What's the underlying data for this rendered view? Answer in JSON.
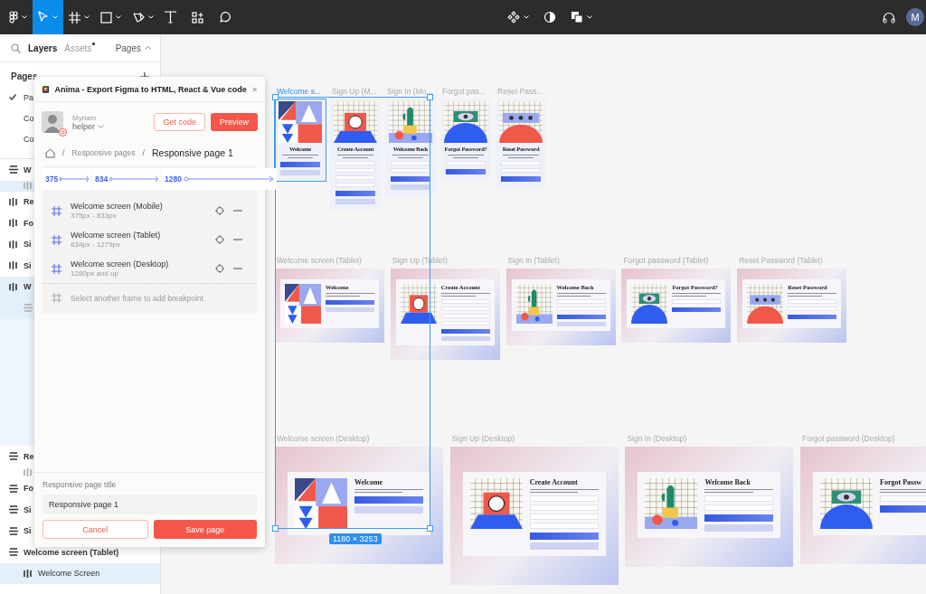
{
  "toolbar": {
    "tools": [
      {
        "kind": "menu",
        "selected": false
      },
      {
        "kind": "move",
        "selected": true
      },
      {
        "kind": "frame",
        "selected": false
      },
      {
        "kind": "shape",
        "selected": false
      },
      {
        "kind": "pen",
        "selected": false
      },
      {
        "kind": "text",
        "selected": false
      },
      {
        "kind": "resources",
        "selected": false
      },
      {
        "kind": "comment",
        "selected": false
      }
    ],
    "user_initial": "M"
  },
  "left_panel": {
    "tabs": [
      {
        "label": "Layers",
        "selected": true,
        "has_updates": false
      },
      {
        "label": "Assets",
        "selected": false,
        "has_updates": true
      }
    ],
    "pages_toggle": "Pages",
    "pages": {
      "title": "Pages",
      "items": [
        {
          "label": "Pa",
          "selected": true
        },
        {
          "label": "Co",
          "selected": false
        },
        {
          "label": "Co",
          "selected": false
        }
      ]
    },
    "layers": [
      {
        "kind": "column",
        "label": "W",
        "selected": false,
        "children": [
          {
            "kind": "row",
            "selected": true
          }
        ]
      },
      {
        "kind": "row",
        "label": "Re",
        "selected": false
      },
      {
        "kind": "row",
        "label": "Fo",
        "selected": false
      },
      {
        "kind": "row",
        "label": "Si",
        "selected": false
      },
      {
        "kind": "row",
        "label": "Si",
        "selected": false
      },
      {
        "kind": "row",
        "label": "W",
        "selected": true,
        "children": [
          {
            "kind": "column",
            "selected": true
          }
        ]
      },
      {
        "kind": "column",
        "label": "Re",
        "selected": false,
        "children": [
          {
            "kind": "row",
            "selected": false
          }
        ]
      },
      {
        "kind": "column",
        "label": "Fo",
        "selected": false
      },
      {
        "kind": "column",
        "label": "Si",
        "selected": false
      },
      {
        "kind": "column",
        "label": "Si",
        "selected": false
      },
      {
        "kind": "column",
        "label": "Welcome screen (Tablet)",
        "selected": false,
        "children": [
          {
            "kind": "row",
            "label": "Welcome Screen",
            "selected": true
          }
        ]
      }
    ]
  },
  "plugin": {
    "title": "Anima - Export Figma to HTML, React & Vue code",
    "user": {
      "name": "Myriam",
      "role": "helper"
    },
    "get_code": "Get code",
    "preview": "Preview",
    "breadcrumb": [
      {
        "sep": "/",
        "label": "Responsive pages",
        "selected": false
      },
      {
        "sep": "/",
        "label": "Responsive page 1",
        "selected": true
      }
    ],
    "breakpoints": [
      "375",
      "834",
      "1280"
    ],
    "frames": [
      {
        "name": "Welcome screen (Mobile)",
        "range": "375px - 833px"
      },
      {
        "name": "Welcome screen (Tablet)",
        "range": "834px - 1279px"
      },
      {
        "name": "Welcome screen (Desktop)",
        "range": "1280px and up"
      }
    ],
    "add_hint": "Select another frame to add breakpoint",
    "title_field": {
      "label": "Responsive page title",
      "value": "Responsive page 1"
    },
    "cancel": "Cancel",
    "save": "Save page"
  },
  "canvas": {
    "rows": [
      {
        "kind": "mobile",
        "frames": [
          {
            "label": "Welcome s...",
            "kind": "welcome",
            "heading": "Welcome",
            "selected": true
          },
          {
            "label": "Sign Up (M...",
            "kind": "signup",
            "heading": "Create Account",
            "selected": false
          },
          {
            "label": "Sign In (Mo...",
            "kind": "signin",
            "heading": "Welcome Back",
            "selected": false
          },
          {
            "label": "Forgot pas...",
            "kind": "forgot",
            "heading": "Forgot Password?",
            "selected": false
          },
          {
            "label": "Reset Pass...",
            "kind": "reset",
            "heading": "Reset Password",
            "selected": false
          }
        ]
      },
      {
        "kind": "tablet",
        "frames": [
          {
            "label": "Welcome screen (Tablet)",
            "kind": "welcome",
            "heading": "Welcome",
            "selected": false
          },
          {
            "label": "Sign Up (Tablet)",
            "kind": "signup",
            "heading": "Create Account",
            "selected": false
          },
          {
            "label": "Sign In (Tablet)",
            "kind": "signin",
            "heading": "Welcome Back",
            "selected": false
          },
          {
            "label": "Forgot password (Tablet)",
            "kind": "forgot",
            "heading": "Forgot Password?",
            "selected": false
          },
          {
            "label": "Reset Password (Tablet)",
            "kind": "reset",
            "heading": "Reset Password",
            "selected": false
          }
        ]
      },
      {
        "kind": "desktop",
        "frames": [
          {
            "label": "Welcome screen (Desktop)",
            "kind": "welcome",
            "heading": "Welcome",
            "selected": false
          },
          {
            "label": "Sign Up (Desktop)",
            "kind": "signup",
            "heading": "Create Account",
            "selected": false
          },
          {
            "label": "Sign In (Desktop)",
            "kind": "signin",
            "heading": "Welcome Back",
            "selected": false
          },
          {
            "label": "Forgot password (Desktop)",
            "kind": "forgot",
            "heading": "Forgot Passw",
            "selected": false
          }
        ]
      }
    ],
    "selection": {
      "size": "1180 × 3253"
    }
  }
}
